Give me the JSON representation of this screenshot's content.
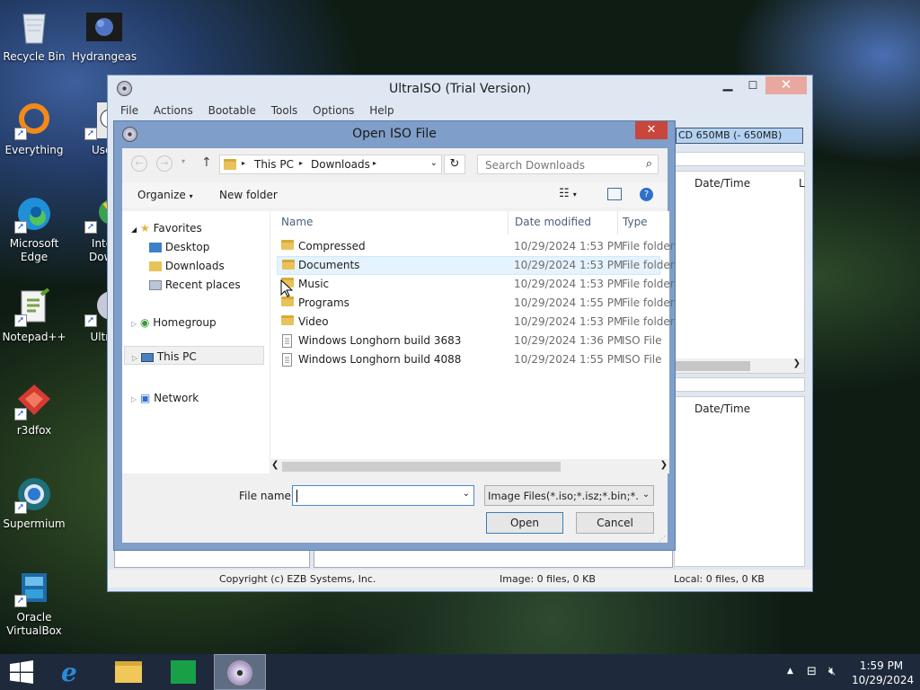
{
  "desktop": {
    "icons": [
      {
        "label": "Recycle Bin",
        "icon": "recycle-bin-icon"
      },
      {
        "label": "Hydrangeas",
        "icon": "image-file-icon"
      },
      {
        "label": "Everything",
        "icon": "everything-search-icon"
      },
      {
        "label": "Usertile",
        "icon": "usertile-icon"
      },
      {
        "label": "Microsoft Edge",
        "icon": "edge-icon"
      },
      {
        "label": "Inter Down",
        "icon": "download-manager-icon"
      },
      {
        "label": "Notepad++",
        "icon": "notepadpp-icon"
      },
      {
        "label": "Ultra",
        "icon": "ultraiso-icon"
      },
      {
        "label": "r3dfox",
        "icon": "r3dfox-icon"
      },
      {
        "label": "Supermium",
        "icon": "supermium-icon"
      },
      {
        "label": "Oracle VirtualBox",
        "icon": "virtualbox-icon"
      }
    ]
  },
  "ultraiso": {
    "title": "UltraISO (Trial Version)",
    "menu": [
      "File",
      "Actions",
      "Bootable",
      "Tools",
      "Options",
      "Help"
    ],
    "media_size": "CD 650MB (- 650MB)",
    "col_datetime_top": "Date/Time",
    "col_l": "L",
    "col_datetime_bottom": "Date/Time",
    "status": {
      "copyright": "Copyright (c) EZB Systems, Inc.",
      "image": "Image: 0 files, 0 KB",
      "local": "Local: 0 files, 0 KB"
    }
  },
  "dialog": {
    "title": "Open ISO File",
    "path": [
      "This PC",
      "Downloads"
    ],
    "search_placeholder": "Search Downloads",
    "toolbar": {
      "organize": "Organize",
      "new_folder": "New folder"
    },
    "tree": [
      {
        "label": "Favorites",
        "level": 0
      },
      {
        "label": "Desktop",
        "level": 1
      },
      {
        "label": "Downloads",
        "level": 1
      },
      {
        "label": "Recent places",
        "level": 1
      },
      {
        "label": "Homegroup",
        "level": 0
      },
      {
        "label": "This PC",
        "level": 0
      },
      {
        "label": "Network",
        "level": 0
      }
    ],
    "columns": {
      "name": "Name",
      "date": "Date modified",
      "type": "Type"
    },
    "files": [
      {
        "name": "Compressed",
        "date": "10/29/2024 1:53 PM",
        "type": "File folder",
        "kind": "folder"
      },
      {
        "name": "Documents",
        "date": "10/29/2024 1:53 PM",
        "type": "File folder",
        "kind": "folder"
      },
      {
        "name": "Music",
        "date": "10/29/2024 1:53 PM",
        "type": "File folder",
        "kind": "folder"
      },
      {
        "name": "Programs",
        "date": "10/29/2024 1:55 PM",
        "type": "File folder",
        "kind": "folder"
      },
      {
        "name": "Video",
        "date": "10/29/2024 1:53 PM",
        "type": "File folder",
        "kind": "folder"
      },
      {
        "name": "Windows Longhorn build 3683",
        "date": "10/29/2024 1:36 PM",
        "type": "ISO File",
        "kind": "file"
      },
      {
        "name": "Windows Longhorn build 4088",
        "date": "10/29/2024 1:55 PM",
        "type": "ISO File",
        "kind": "file"
      }
    ],
    "filename_label": "File name:",
    "filename_value": "",
    "filter": "Image Files(*.iso;*.isz;*.bin;*.cue",
    "open": "Open",
    "cancel": "Cancel"
  },
  "taskbar": {
    "time": "1:59 PM",
    "date": "10/29/2024"
  },
  "colors": {
    "dialog_frame": "#7f9ec9",
    "close_red": "#c9463d",
    "selection": "#cce8ff",
    "taskbar": "#1e2a3c"
  }
}
